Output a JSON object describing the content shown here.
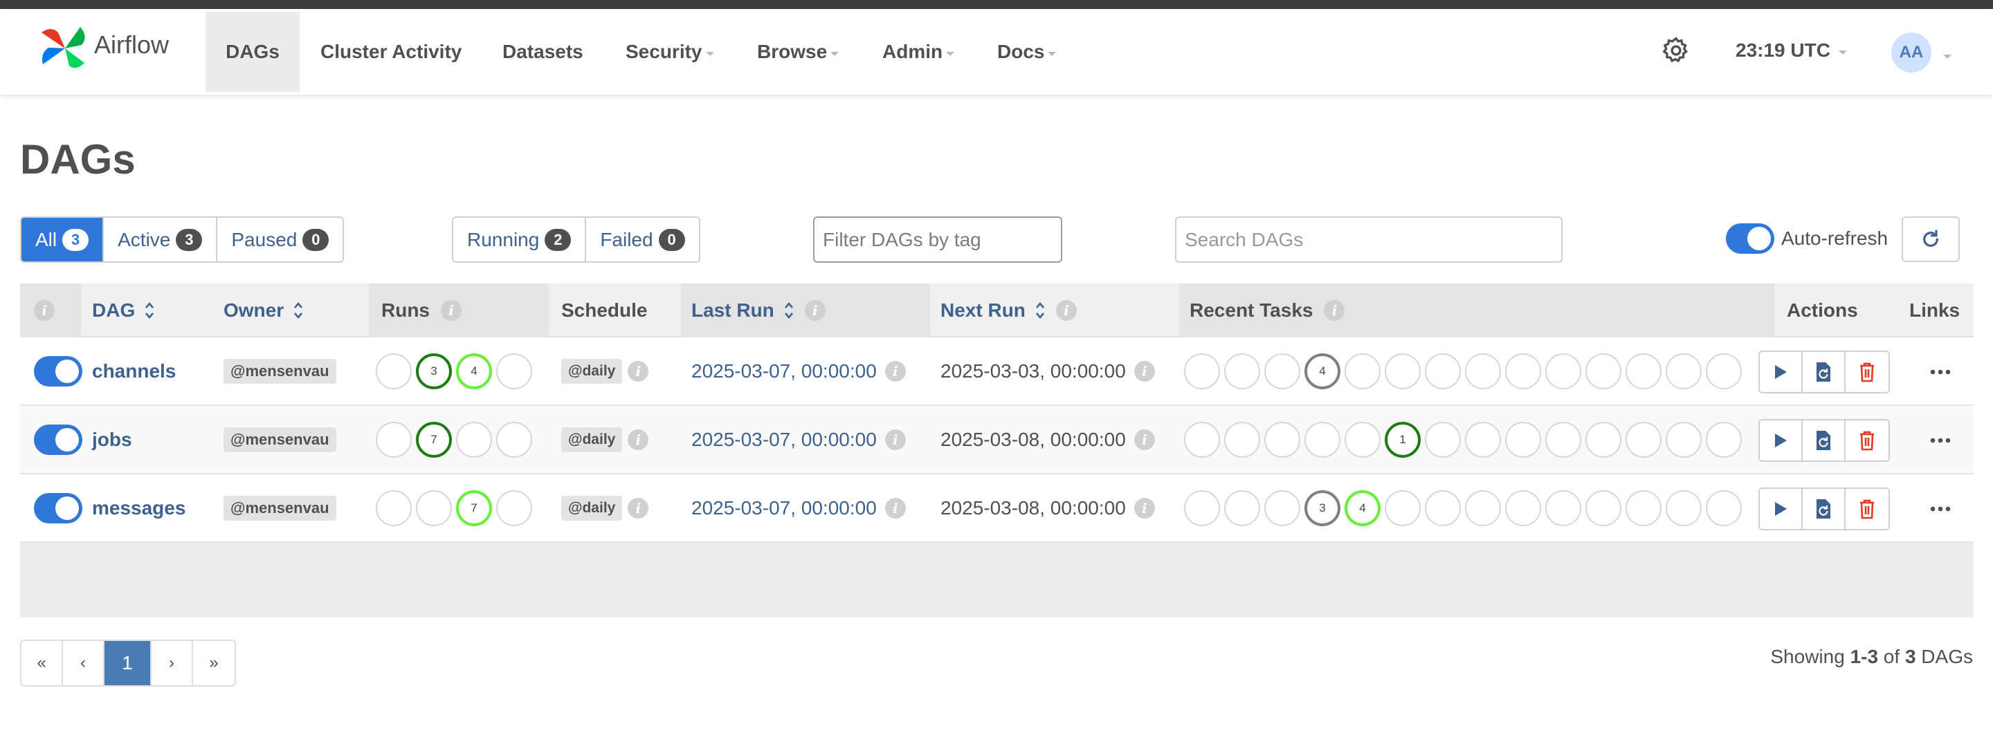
{
  "app": {
    "brand": "Airflow"
  },
  "nav": {
    "items": [
      {
        "label": "DAGs"
      },
      {
        "label": "Cluster Activity"
      },
      {
        "label": "Datasets"
      },
      {
        "label": "Security"
      },
      {
        "label": "Browse"
      },
      {
        "label": "Admin"
      },
      {
        "label": "Docs"
      }
    ],
    "time": "23:19 UTC",
    "avatar": "AA"
  },
  "page": {
    "title": "DAGs"
  },
  "filters": {
    "status": [
      {
        "label": "All",
        "count": "3"
      },
      {
        "label": "Active",
        "count": "3"
      },
      {
        "label": "Paused",
        "count": "0"
      }
    ],
    "runs": [
      {
        "label": "Running",
        "count": "2"
      },
      {
        "label": "Failed",
        "count": "0"
      }
    ],
    "tag_placeholder": "Filter DAGs by tag",
    "search_placeholder": "Search DAGs",
    "autorefresh_label": "Auto-refresh"
  },
  "table": {
    "headers": {
      "info": "i",
      "dag": "DAG",
      "owner": "Owner",
      "runs": "Runs",
      "schedule": "Schedule",
      "last_run": "Last Run",
      "next_run": "Next Run",
      "recent_tasks": "Recent Tasks",
      "actions": "Actions",
      "links": "Links"
    },
    "rows": [
      {
        "name": "channels",
        "owner": "@mensenvau",
        "schedule": "@daily",
        "last_run": "2025-03-07, 00:00:00",
        "next_run": "2025-03-03, 00:00:00",
        "runs": [
          {
            "state": "empty",
            "count": ""
          },
          {
            "state": "success",
            "count": "3"
          },
          {
            "state": "running",
            "count": "4"
          },
          {
            "state": "empty",
            "count": ""
          }
        ],
        "tasks": [
          {
            "state": "empty",
            "count": ""
          },
          {
            "state": "empty",
            "count": ""
          },
          {
            "state": "empty",
            "count": ""
          },
          {
            "state": "queued",
            "count": "4"
          },
          {
            "state": "empty",
            "count": ""
          },
          {
            "state": "empty",
            "count": ""
          },
          {
            "state": "empty",
            "count": ""
          },
          {
            "state": "empty",
            "count": ""
          },
          {
            "state": "empty",
            "count": ""
          },
          {
            "state": "empty",
            "count": ""
          },
          {
            "state": "empty",
            "count": ""
          },
          {
            "state": "empty",
            "count": ""
          },
          {
            "state": "empty",
            "count": ""
          },
          {
            "state": "empty",
            "count": ""
          }
        ]
      },
      {
        "name": "jobs",
        "owner": "@mensenvau",
        "schedule": "@daily",
        "last_run": "2025-03-07, 00:00:00",
        "next_run": "2025-03-08, 00:00:00",
        "runs": [
          {
            "state": "empty",
            "count": ""
          },
          {
            "state": "success",
            "count": "7"
          },
          {
            "state": "empty",
            "count": ""
          },
          {
            "state": "empty",
            "count": ""
          }
        ],
        "tasks": [
          {
            "state": "empty",
            "count": ""
          },
          {
            "state": "empty",
            "count": ""
          },
          {
            "state": "empty",
            "count": ""
          },
          {
            "state": "empty",
            "count": ""
          },
          {
            "state": "empty",
            "count": ""
          },
          {
            "state": "success",
            "count": "1"
          },
          {
            "state": "empty",
            "count": ""
          },
          {
            "state": "empty",
            "count": ""
          },
          {
            "state": "empty",
            "count": ""
          },
          {
            "state": "empty",
            "count": ""
          },
          {
            "state": "empty",
            "count": ""
          },
          {
            "state": "empty",
            "count": ""
          },
          {
            "state": "empty",
            "count": ""
          },
          {
            "state": "empty",
            "count": ""
          }
        ]
      },
      {
        "name": "messages",
        "owner": "@mensenvau",
        "schedule": "@daily",
        "last_run": "2025-03-07, 00:00:00",
        "next_run": "2025-03-08, 00:00:00",
        "runs": [
          {
            "state": "empty",
            "count": ""
          },
          {
            "state": "empty",
            "count": ""
          },
          {
            "state": "running",
            "count": "7"
          },
          {
            "state": "empty",
            "count": ""
          }
        ],
        "tasks": [
          {
            "state": "empty",
            "count": ""
          },
          {
            "state": "empty",
            "count": ""
          },
          {
            "state": "empty",
            "count": ""
          },
          {
            "state": "queued",
            "count": "3"
          },
          {
            "state": "running",
            "count": "4"
          },
          {
            "state": "empty",
            "count": ""
          },
          {
            "state": "empty",
            "count": ""
          },
          {
            "state": "empty",
            "count": ""
          },
          {
            "state": "empty",
            "count": ""
          },
          {
            "state": "empty",
            "count": ""
          },
          {
            "state": "empty",
            "count": ""
          },
          {
            "state": "empty",
            "count": ""
          },
          {
            "state": "empty",
            "count": ""
          },
          {
            "state": "empty",
            "count": ""
          }
        ]
      }
    ]
  },
  "pagination": {
    "first": "«",
    "prev": "‹",
    "current": "1",
    "next": "›",
    "last": "»",
    "showing_prefix": "Showing ",
    "showing_range": "1-3",
    "showing_of": " of ",
    "showing_total": "3",
    "showing_suffix": " DAGs"
  },
  "colors": {
    "accent": "#3077db",
    "link": "#3e618d",
    "success": "#1e7d12",
    "running": "#66f03a",
    "queued": "#808080",
    "delete": "#e43921"
  },
  "icons": {
    "gear": "gear-icon",
    "refresh": "refresh-icon",
    "trigger": "play-icon",
    "clear": "file-refresh-icon",
    "delete": "trash-icon",
    "more": "ellipsis-icon",
    "sort": "sort-icon",
    "info": "info-icon"
  }
}
